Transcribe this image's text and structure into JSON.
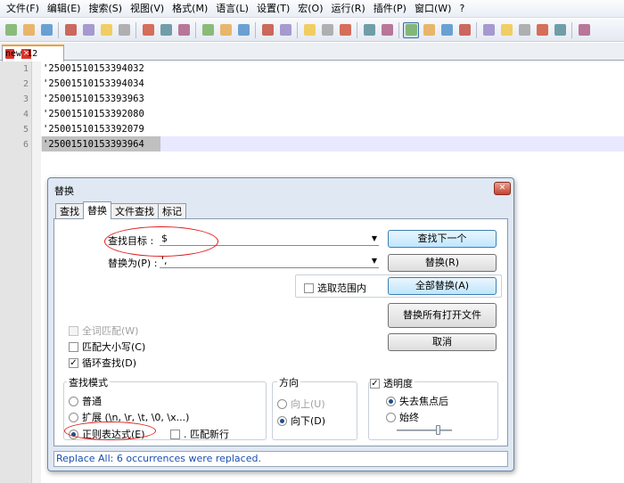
{
  "menu": [
    "文件(F)",
    "编辑(E)",
    "搜索(S)",
    "视图(V)",
    "格式(M)",
    "语言(L)",
    "设置(T)",
    "宏(O)",
    "运行(R)",
    "插件(P)",
    "窗口(W)",
    "?"
  ],
  "tab": {
    "label": "new 12",
    "close": "×"
  },
  "lines": [
    {
      "num": "1",
      "text": "'25001510153394032"
    },
    {
      "num": "2",
      "text": "'25001510153394034"
    },
    {
      "num": "3",
      "text": "'25001510153393963"
    },
    {
      "num": "4",
      "text": "'25001510153392080"
    },
    {
      "num": "5",
      "text": "'25001510153392079"
    },
    {
      "num": "6",
      "text": "'25001510153393964"
    }
  ],
  "dialog": {
    "title": "替换",
    "close": "✕",
    "tabs": [
      "查找",
      "替换",
      "文件查找",
      "标记"
    ],
    "find_label": "查找目标 :",
    "find_value": "$",
    "replace_label": "替换为(P) :",
    "replace_value": "',",
    "in_selection": "选取范围内",
    "buttons": {
      "find_next": "查找下一个",
      "replace": "替换(R)",
      "replace_all": "全部替换(A)",
      "replace_all_open": "替换所有打开文件",
      "cancel": "取消"
    },
    "options": {
      "whole_word": "全词匹配(W)",
      "match_case": "匹配大小写(C)",
      "wrap": "循环查找(D)"
    },
    "mode": {
      "title": "查找模式",
      "normal": "普通",
      "extended": "扩展 (\\n, \\r, \\t, \\0, \\x...)",
      "regex": "正则表达式(E)",
      "dot_newline": ". 匹配新行"
    },
    "direction": {
      "title": "方向",
      "up": "向上(U)",
      "down": "向下(D)"
    },
    "transparency": {
      "title": "透明度",
      "lose_focus": "失去焦点后",
      "always": "始终"
    },
    "status": "Replace All: 6 occurrences were replaced."
  },
  "colors": {
    "accent": "#3c7fb1",
    "status_text": "#1a4fb0",
    "annotation": "#e01b1b"
  }
}
